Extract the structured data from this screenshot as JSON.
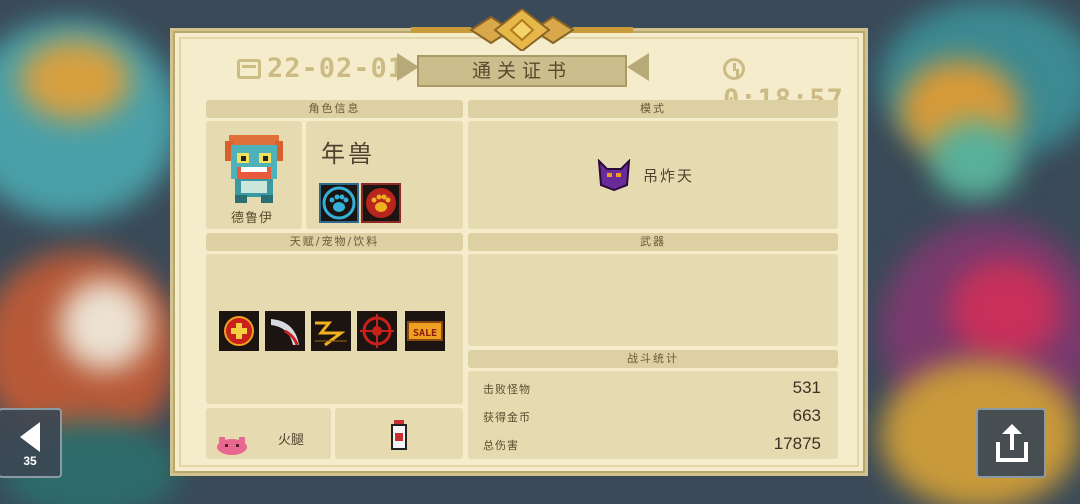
{
  "certificate": {
    "date": "22-02-01",
    "time": "0:18:57",
    "title": "通关证书"
  },
  "sections": {
    "character_header": "角色信息",
    "mode_header": "模式",
    "talents_header": "天赋/宠物/饮料",
    "weapons_header": "武器",
    "stats_header": "战斗统计"
  },
  "character": {
    "hero_name": "年兽",
    "character_name": "德鲁伊",
    "skill_icons": [
      "paw-blue-icon",
      "paw-red-icon"
    ]
  },
  "mode": {
    "label": "吊炸天",
    "icon": "purple-demon-icon"
  },
  "talents": {
    "icons": [
      "health-cross-icon",
      "blade-slash-icon",
      "lightning-icon",
      "target-crosshair-icon",
      "sale-tag-icon"
    ]
  },
  "pet": {
    "name": "火腿",
    "icon": "pink-pig-icon"
  },
  "drink": {
    "icon": "milk-bottle-icon"
  },
  "stats": {
    "kills_label": "击败怪物",
    "kills_value": "531",
    "gold_label": "获得金币",
    "gold_value": "663",
    "damage_label": "总伤害",
    "damage_value": "17875"
  },
  "controls": {
    "back_count": "35"
  },
  "colors": {
    "card_bg": "#f4ecca",
    "panel_bg": "#e6dbb0",
    "header_bg": "#ddd0a2",
    "accent_gold": "#cdbb86"
  }
}
